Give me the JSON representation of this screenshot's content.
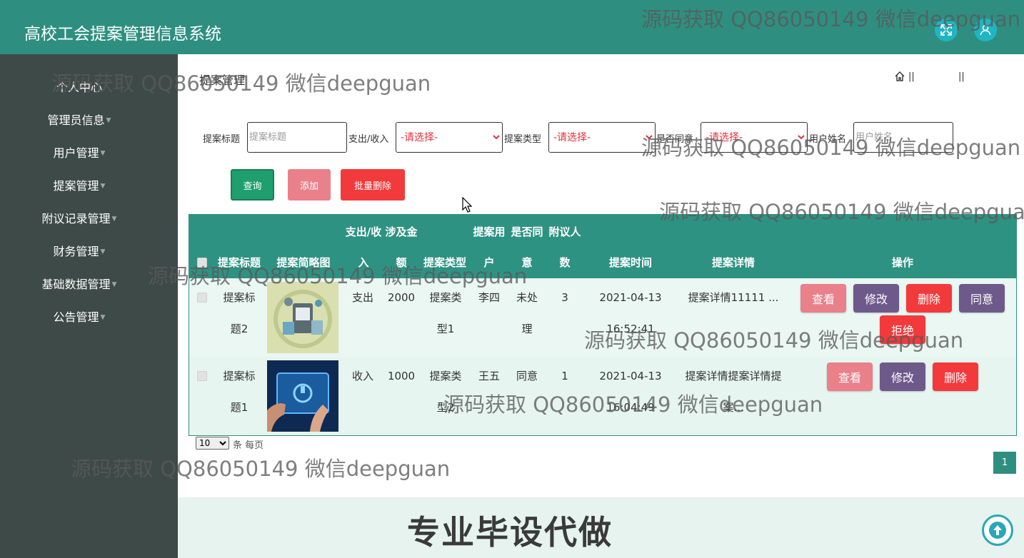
{
  "header": {
    "title": "高校工会提案管理信息系统",
    "fullscreen_icon": "expand-icon",
    "user_icon": "user-icon"
  },
  "sidebar": {
    "items": [
      {
        "label": "个人中心"
      },
      {
        "label": "管理员信息"
      },
      {
        "label": "用户管理"
      },
      {
        "label": "提案管理"
      },
      {
        "label": "附议记录管理"
      },
      {
        "label": "财务管理"
      },
      {
        "label": "基础数据管理"
      },
      {
        "label": "公告管理"
      }
    ]
  },
  "page": {
    "title": "提案管理",
    "breadcrumb_sep1": "||",
    "breadcrumb_sep2": "||"
  },
  "filters": {
    "title_label": "提案标题",
    "title_placeholder": "提案标题",
    "inout_label": "支出/收入",
    "inout_value": "-请选择-",
    "type_label": "提案类型",
    "type_value": "-请选择-",
    "agree_label": "是否同意",
    "agree_value": "-请选择-",
    "user_label": "用户姓名",
    "user_placeholder": "用户姓名"
  },
  "actions": {
    "search": "查询",
    "add": "添加",
    "batch_delete": "批量删除"
  },
  "colors": {
    "primary": "#2e8f80",
    "search_btn": "#1f9e6e",
    "add_btn": "#e9808a",
    "delete_btn": "#f23a3c",
    "edit_btn": "#6e5a8a",
    "sidebar_bg": "#3e4a47"
  },
  "table": {
    "headers": {
      "title": "提案标题",
      "image": "提案简略图",
      "inout_1": "支出/收",
      "inout_2": "入",
      "amount_1": "涉及金",
      "amount_2": "额",
      "type": "提案类型",
      "user_1": "提案用",
      "user_2": "户",
      "agree_1": "是否同",
      "agree_2": "意",
      "count_1": "附议人",
      "count_2": "数",
      "time": "提案时间",
      "detail": "提案详情",
      "ops": "操作"
    },
    "rows": [
      {
        "title_1": "提案标",
        "title_2": "题2",
        "inout": "支出",
        "amount": "2000",
        "type_1": "提案类",
        "type_2": "型1",
        "user": "李四",
        "agree_1": "未处",
        "agree_2": "理",
        "count": "3",
        "time_1": "2021-04-13",
        "time_2": "16:52:41",
        "detail_1": "提案详情11111 ...",
        "detail_2": "",
        "btn_view": "查看",
        "btn_edit": "修改",
        "btn_delete": "删除",
        "btn_agree": "同意",
        "btn_reject": "拒绝"
      },
      {
        "title_1": "提案标",
        "title_2": "题1",
        "inout": "收入",
        "amount": "1000",
        "type_1": "提案类",
        "type_2": "型2",
        "user": "王五",
        "agree_1": "同意",
        "agree_2": "",
        "count": "1",
        "time_1": "2021-04-13",
        "time_2": "16:04:49",
        "detail_1": "提案详情提案详情提",
        "detail_2": "案...",
        "btn_view": "查看",
        "btn_edit": "修改",
        "btn_delete": "删除"
      }
    ]
  },
  "pagination": {
    "page_size": "10",
    "page_size_suffix": "条 每页",
    "current_page": "1"
  },
  "overlay": {
    "watermark": "源码获取 QQ86050149 微信deepguan",
    "promo": "专业毕设代做"
  }
}
